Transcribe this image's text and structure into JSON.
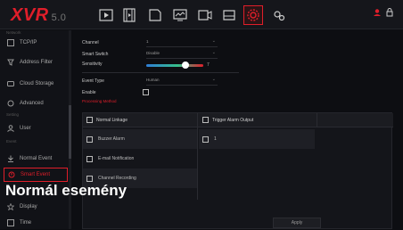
{
  "app": {
    "logo": "XVR",
    "version": "5.0"
  },
  "topbar": {
    "icons": [
      "playback-icon",
      "video-icon",
      "file-icon",
      "monitor-icon",
      "camera-icon",
      "hdd-icon",
      "settings-icon",
      "system-icon"
    ],
    "active": "settings-icon",
    "accent": "#e01e2a"
  },
  "sidebar": {
    "sections": {
      "network": "Network",
      "setting": "Setting",
      "event": "Event"
    },
    "items": [
      {
        "label": "TCP/IP",
        "icon": "ip-icon"
      },
      {
        "label": "Address Filter",
        "icon": "filter-icon"
      },
      {
        "label": "Cloud Storage",
        "icon": "cloud-icon"
      },
      {
        "label": "Advanced",
        "icon": "advanced-icon"
      },
      {
        "label": "User",
        "icon": "user-icon"
      },
      {
        "label": "Normal Event",
        "icon": "normal-event-icon"
      },
      {
        "label": "Smart Event",
        "icon": "smart-event-icon"
      },
      {
        "label": "Display",
        "icon": "display-icon"
      },
      {
        "label": "Time",
        "icon": "time-icon"
      }
    ]
  },
  "form": {
    "channel_label": "Channel",
    "channel_value": "1",
    "smart_switch_label": "Smart Switch",
    "smart_switch_value": "Disable",
    "sensitivity_label": "Sensitivity",
    "sensitivity_value": "7",
    "event_type_label": "Event Type",
    "event_type_value": "Human",
    "enable_label": "Enable",
    "warning": "Processing Method"
  },
  "linkage": {
    "normal_header": "Normal Linkage",
    "trigger_header": "Trigger Alarm Output",
    "items": [
      "Buzzer Alarm",
      "E-mail Notification",
      "Channel Recording"
    ],
    "outputs": [
      "1"
    ]
  },
  "caption": "Normál esemény",
  "apply_label": "Apply"
}
